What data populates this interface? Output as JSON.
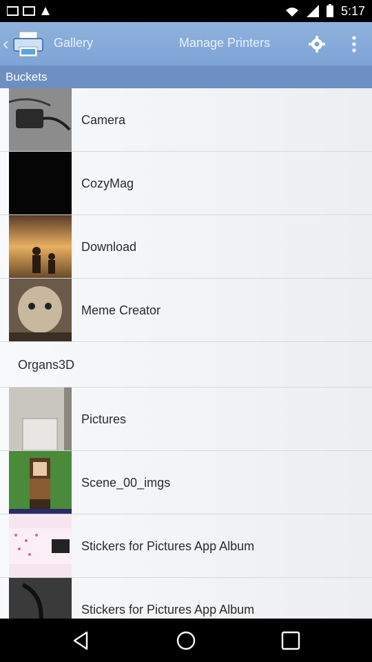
{
  "status_bar": {
    "time": "5:17"
  },
  "app_bar": {
    "title": "Gallery",
    "action_label": "Manage Printers",
    "icons": [
      "back-chevron-icon",
      "printer-app-icon",
      "gear-icon",
      "more-vert-icon"
    ]
  },
  "section_header": "Buckets",
  "buckets": [
    {
      "label": "Camera",
      "thumb": "camera-thumb"
    },
    {
      "label": "CozyMag",
      "thumb": "cozymag-thumb"
    },
    {
      "label": "Download",
      "thumb": "download-thumb"
    },
    {
      "label": "Meme Creator",
      "thumb": "meme-thumb"
    },
    {
      "label": "Organs3D",
      "thumb": null
    },
    {
      "label": "Pictures",
      "thumb": "pictures-thumb"
    },
    {
      "label": "Scene_00_imgs",
      "thumb": "scene-thumb"
    },
    {
      "label": "Stickers for Pictures App Album",
      "thumb": "stickers-thumb"
    },
    {
      "label": "Stickers for Pictures App Album",
      "thumb": "stickers2-thumb"
    }
  ],
  "colors": {
    "app_bar": "#7ea4d6",
    "section_header": "#6e8fc2",
    "list_bg": "#f0f1f3"
  },
  "nav_bar": {
    "icons": [
      "back-icon",
      "home-icon",
      "recents-icon"
    ]
  }
}
